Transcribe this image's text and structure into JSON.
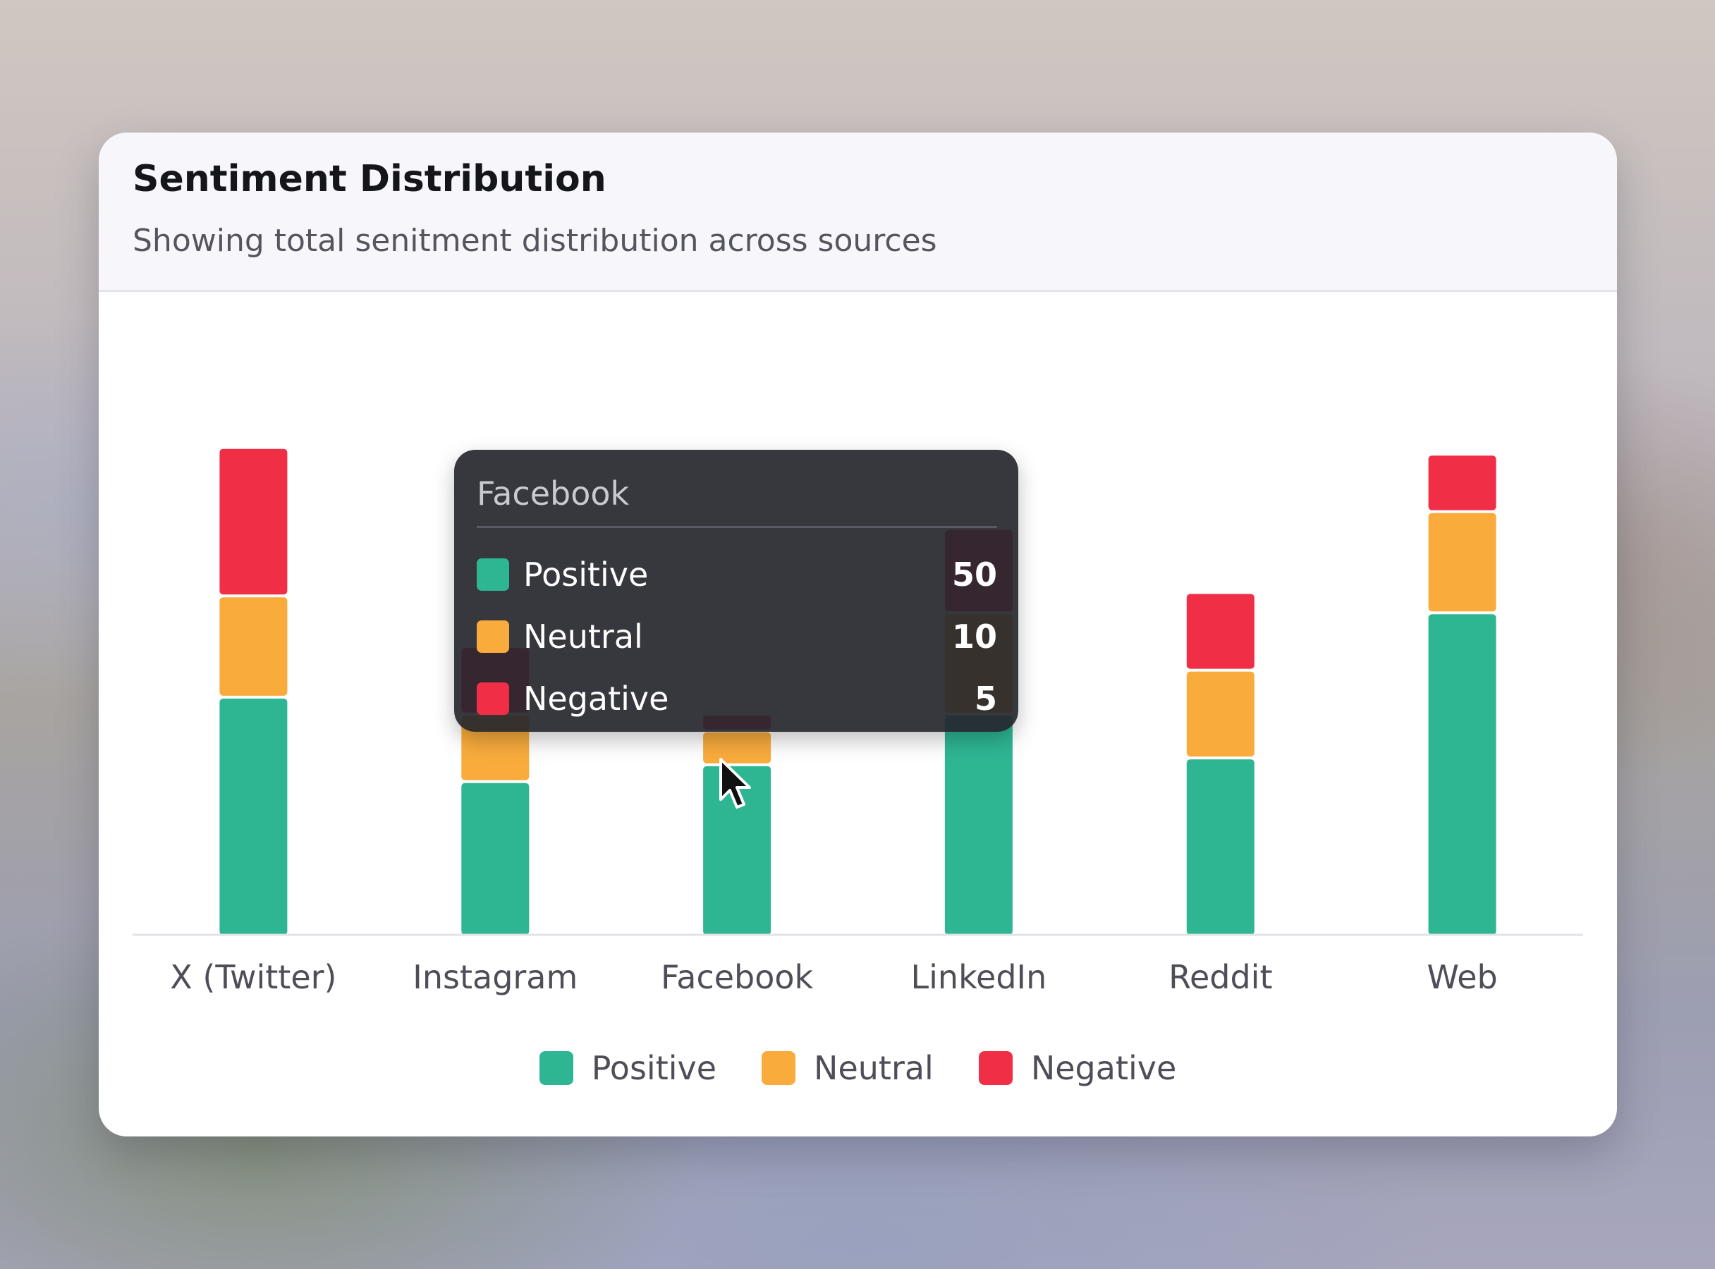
{
  "card": {
    "title": "Sentiment Distribution",
    "subtitle": "Showing total senitment distribution across sources"
  },
  "colors": {
    "positive": "#2eb693",
    "neutral": "#f9ab3c",
    "negative": "#f02e45",
    "tooltip_bg": "#26262e"
  },
  "chart_data": {
    "type": "bar",
    "stacked": true,
    "categories": [
      "X (Twitter)",
      "Instagram",
      "Facebook",
      "LinkedIn",
      "Reddit",
      "Web"
    ],
    "series": [
      {
        "name": "Positive",
        "values": [
          70,
          45,
          50,
          65,
          52,
          95
        ]
      },
      {
        "name": "Neutral",
        "values": [
          30,
          20,
          10,
          30,
          26,
          30
        ]
      },
      {
        "name": "Negative",
        "values": [
          44,
          20,
          5,
          25,
          23,
          17
        ]
      }
    ],
    "ylim": [
      0,
      150
    ],
    "grid": false,
    "legend_position": "bottom-center"
  },
  "legend": [
    {
      "label": "Positive",
      "key": "positive"
    },
    {
      "label": "Neutral",
      "key": "neutral"
    },
    {
      "label": "Negative",
      "key": "negative"
    }
  ],
  "tooltip": {
    "title": "Facebook",
    "rows": [
      {
        "label": "Positive",
        "value": "50",
        "key": "positive"
      },
      {
        "label": "Neutral",
        "value": "10",
        "key": "neutral"
      },
      {
        "label": "Negative",
        "value": "5",
        "key": "negative"
      }
    ]
  }
}
